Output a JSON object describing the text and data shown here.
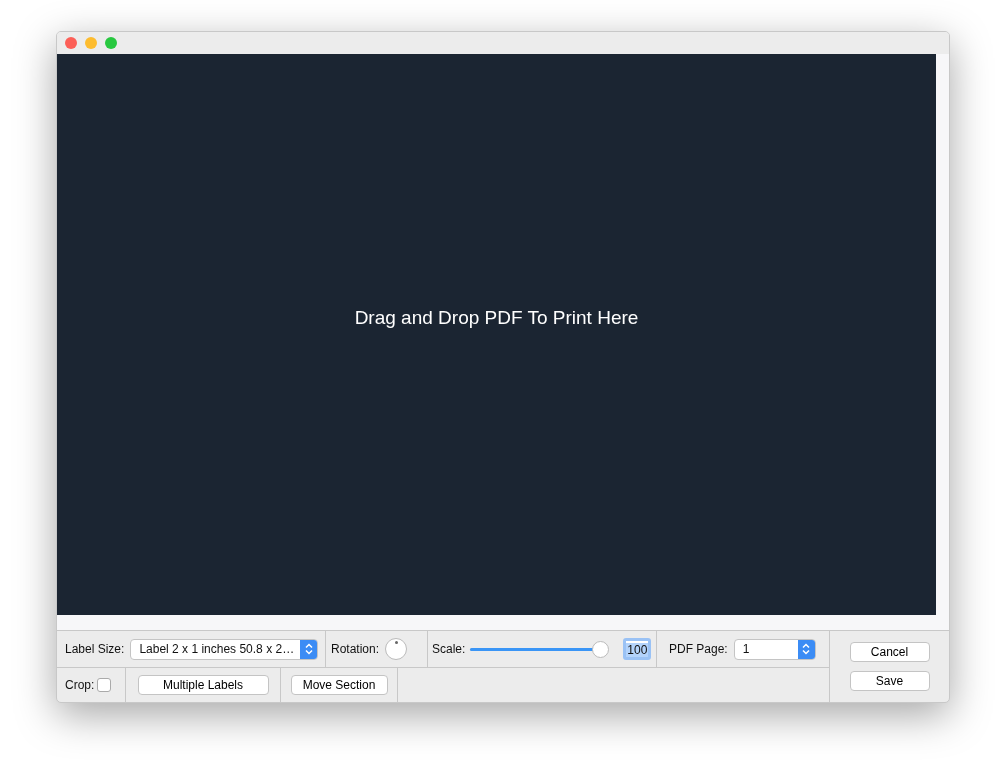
{
  "drop_area": {
    "message": "Drag and Drop PDF To Print Here"
  },
  "toolbar": {
    "label_size": {
      "label": "Label Size:",
      "value": "Label 2 x 1 inches 50.8 x 2…"
    },
    "rotation": {
      "label": "Rotation:"
    },
    "scale": {
      "label": "Scale:",
      "level": 0.95,
      "value": "100"
    },
    "pdf_page": {
      "label": "PDF Page:",
      "value": "1"
    },
    "crop": {
      "label": "Crop:",
      "checked": false
    },
    "buttons": [
      "Multiple Labels",
      "Move Section"
    ]
  },
  "actions": [
    "Cancel",
    "Save"
  ]
}
